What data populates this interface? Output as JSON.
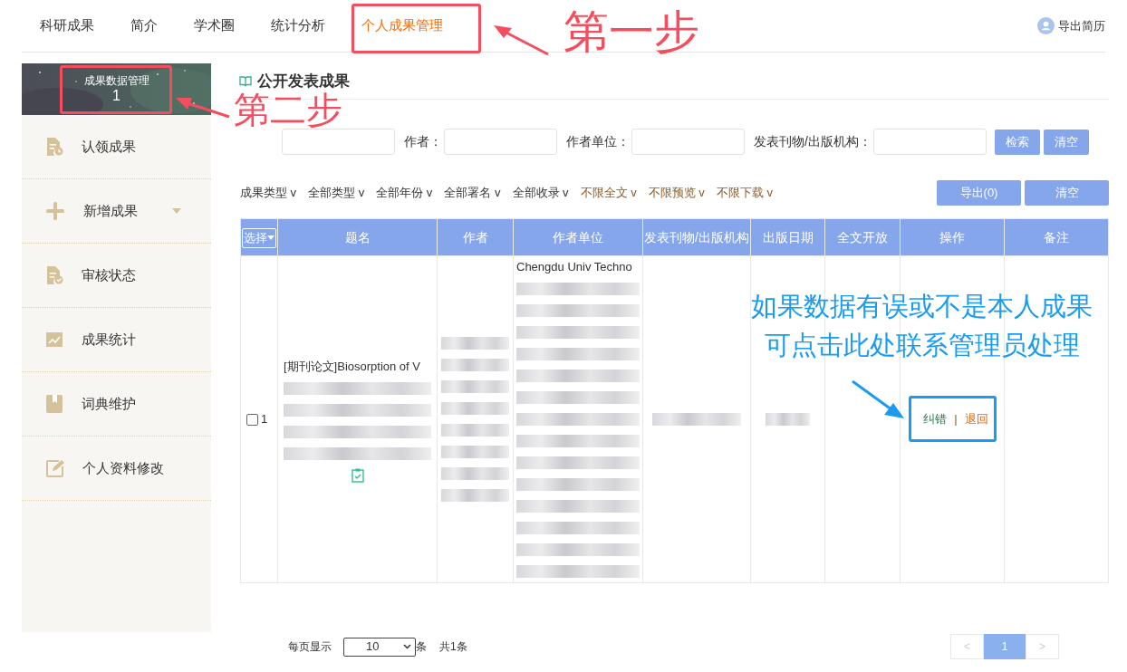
{
  "nav": {
    "tabs": [
      {
        "label": "科研成果",
        "selected": false
      },
      {
        "label": "简介",
        "selected": false
      },
      {
        "label": "学术圈",
        "selected": false
      },
      {
        "label": "统计分析",
        "selected": false
      },
      {
        "label": "个人成果管理",
        "selected": true
      }
    ],
    "export_resume": "导出简历"
  },
  "sidebar": {
    "header": {
      "title": "成果数据管理",
      "count": "1"
    },
    "items": [
      {
        "label": "认领成果",
        "expandable": false
      },
      {
        "label": "新增成果",
        "expandable": true
      },
      {
        "label": "审核状态",
        "expandable": false
      },
      {
        "label": "成果统计",
        "expandable": false
      },
      {
        "label": "词典维护",
        "expandable": false
      },
      {
        "label": "个人资料修改",
        "expandable": false
      }
    ]
  },
  "section_title": "公开发表成果",
  "search": {
    "fields": [
      {
        "kind": "covered"
      },
      {
        "kind": "labeled",
        "label": "作者："
      },
      {
        "kind": "labeled",
        "label": "作者单位："
      },
      {
        "kind": "labeled",
        "label": "发表刊物/出版机构："
      }
    ],
    "buttons": [
      "检索",
      "清空"
    ]
  },
  "filters": [
    "成果类型 v",
    "全部类型 v",
    "全部年份 v",
    "全部署名 v",
    "全部收录 v",
    "不限全文 v",
    "不限预览 v",
    "不限下载 v"
  ],
  "filter_actions": [
    "导出(0)",
    "清空"
  ],
  "table": {
    "select_header": "选择",
    "columns": [
      "题名",
      "作者",
      "作者单位",
      "发表刊物/出版机构",
      "出版日期",
      "全文开放",
      "操作",
      "备注"
    ],
    "rows": [
      {
        "checked": false,
        "index": "1",
        "title": [
          {
            "kind": "text",
            "text": "[期刊论文]Biosorption of V"
          },
          {
            "kind": "blurred"
          },
          {
            "kind": "blurred"
          },
          {
            "kind": "blurred"
          },
          {
            "kind": "blurred"
          }
        ],
        "authors": [
          {
            "kind": "blurred"
          },
          {
            "kind": "blurred"
          },
          {
            "kind": "blurred"
          },
          {
            "kind": "blurred"
          },
          {
            "kind": "blurred"
          },
          {
            "kind": "blurred"
          },
          {
            "kind": "blurred"
          },
          {
            "kind": "blurred"
          }
        ],
        "affiliation": [
          {
            "kind": "text",
            "text": "Chengdu Univ Techno"
          },
          {
            "kind": "blurred"
          },
          {
            "kind": "blurred"
          },
          {
            "kind": "blurred"
          },
          {
            "kind": "blurred"
          },
          {
            "kind": "blurred"
          },
          {
            "kind": "blurred"
          },
          {
            "kind": "blurred"
          },
          {
            "kind": "blurred"
          },
          {
            "kind": "blurred"
          },
          {
            "kind": "blurred"
          },
          {
            "kind": "blurred"
          },
          {
            "kind": "blurred"
          },
          {
            "kind": "blurred"
          },
          {
            "kind": "blurred"
          }
        ],
        "journal": [
          {
            "kind": "blurred"
          }
        ],
        "date": [
          {
            "kind": "blurred"
          }
        ],
        "actions": [
          {
            "kind": "correct",
            "label": "纠错"
          },
          {
            "kind": "separator",
            "label": "|"
          },
          {
            "kind": "return",
            "label": "退回"
          }
        ]
      }
    ]
  },
  "pagination": {
    "per_page_label": "每页显示",
    "per_page": "10",
    "unit": "条",
    "total": "共1条",
    "prev": "<",
    "next": ">",
    "pages": [
      {
        "label": "1",
        "selected": true
      }
    ]
  },
  "annotations": [
    {
      "kind": "step",
      "text": "第一步"
    },
    {
      "kind": "step",
      "text": "第二步"
    },
    {
      "kind": "note",
      "lines": [
        "如果数据有误或不是本人成果",
        "可点击此处联系管理员处理"
      ]
    }
  ]
}
